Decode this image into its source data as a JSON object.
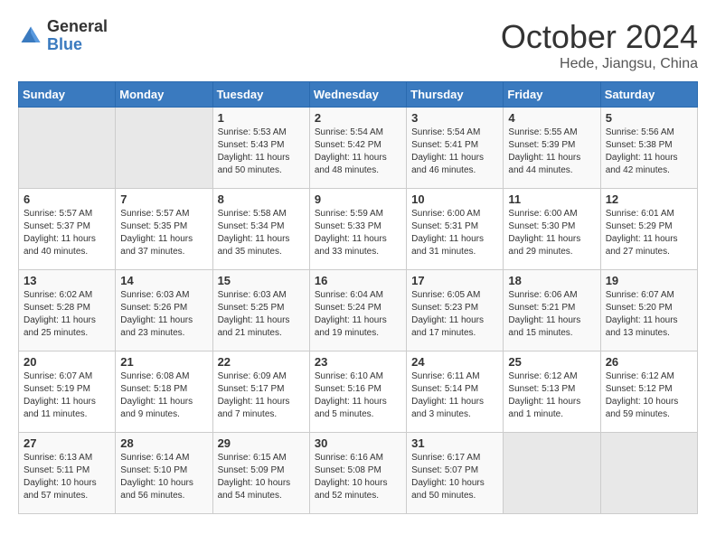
{
  "header": {
    "logo_general": "General",
    "logo_blue": "Blue",
    "month": "October 2024",
    "location": "Hede, Jiangsu, China"
  },
  "weekdays": [
    "Sunday",
    "Monday",
    "Tuesday",
    "Wednesday",
    "Thursday",
    "Friday",
    "Saturday"
  ],
  "weeks": [
    [
      {
        "day": "",
        "info": ""
      },
      {
        "day": "",
        "info": ""
      },
      {
        "day": "1",
        "info": "Sunrise: 5:53 AM\nSunset: 5:43 PM\nDaylight: 11 hours and 50 minutes."
      },
      {
        "day": "2",
        "info": "Sunrise: 5:54 AM\nSunset: 5:42 PM\nDaylight: 11 hours and 48 minutes."
      },
      {
        "day": "3",
        "info": "Sunrise: 5:54 AM\nSunset: 5:41 PM\nDaylight: 11 hours and 46 minutes."
      },
      {
        "day": "4",
        "info": "Sunrise: 5:55 AM\nSunset: 5:39 PM\nDaylight: 11 hours and 44 minutes."
      },
      {
        "day": "5",
        "info": "Sunrise: 5:56 AM\nSunset: 5:38 PM\nDaylight: 11 hours and 42 minutes."
      }
    ],
    [
      {
        "day": "6",
        "info": "Sunrise: 5:57 AM\nSunset: 5:37 PM\nDaylight: 11 hours and 40 minutes."
      },
      {
        "day": "7",
        "info": "Sunrise: 5:57 AM\nSunset: 5:35 PM\nDaylight: 11 hours and 37 minutes."
      },
      {
        "day": "8",
        "info": "Sunrise: 5:58 AM\nSunset: 5:34 PM\nDaylight: 11 hours and 35 minutes."
      },
      {
        "day": "9",
        "info": "Sunrise: 5:59 AM\nSunset: 5:33 PM\nDaylight: 11 hours and 33 minutes."
      },
      {
        "day": "10",
        "info": "Sunrise: 6:00 AM\nSunset: 5:31 PM\nDaylight: 11 hours and 31 minutes."
      },
      {
        "day": "11",
        "info": "Sunrise: 6:00 AM\nSunset: 5:30 PM\nDaylight: 11 hours and 29 minutes."
      },
      {
        "day": "12",
        "info": "Sunrise: 6:01 AM\nSunset: 5:29 PM\nDaylight: 11 hours and 27 minutes."
      }
    ],
    [
      {
        "day": "13",
        "info": "Sunrise: 6:02 AM\nSunset: 5:28 PM\nDaylight: 11 hours and 25 minutes."
      },
      {
        "day": "14",
        "info": "Sunrise: 6:03 AM\nSunset: 5:26 PM\nDaylight: 11 hours and 23 minutes."
      },
      {
        "day": "15",
        "info": "Sunrise: 6:03 AM\nSunset: 5:25 PM\nDaylight: 11 hours and 21 minutes."
      },
      {
        "day": "16",
        "info": "Sunrise: 6:04 AM\nSunset: 5:24 PM\nDaylight: 11 hours and 19 minutes."
      },
      {
        "day": "17",
        "info": "Sunrise: 6:05 AM\nSunset: 5:23 PM\nDaylight: 11 hours and 17 minutes."
      },
      {
        "day": "18",
        "info": "Sunrise: 6:06 AM\nSunset: 5:21 PM\nDaylight: 11 hours and 15 minutes."
      },
      {
        "day": "19",
        "info": "Sunrise: 6:07 AM\nSunset: 5:20 PM\nDaylight: 11 hours and 13 minutes."
      }
    ],
    [
      {
        "day": "20",
        "info": "Sunrise: 6:07 AM\nSunset: 5:19 PM\nDaylight: 11 hours and 11 minutes."
      },
      {
        "day": "21",
        "info": "Sunrise: 6:08 AM\nSunset: 5:18 PM\nDaylight: 11 hours and 9 minutes."
      },
      {
        "day": "22",
        "info": "Sunrise: 6:09 AM\nSunset: 5:17 PM\nDaylight: 11 hours and 7 minutes."
      },
      {
        "day": "23",
        "info": "Sunrise: 6:10 AM\nSunset: 5:16 PM\nDaylight: 11 hours and 5 minutes."
      },
      {
        "day": "24",
        "info": "Sunrise: 6:11 AM\nSunset: 5:14 PM\nDaylight: 11 hours and 3 minutes."
      },
      {
        "day": "25",
        "info": "Sunrise: 6:12 AM\nSunset: 5:13 PM\nDaylight: 11 hours and 1 minute."
      },
      {
        "day": "26",
        "info": "Sunrise: 6:12 AM\nSunset: 5:12 PM\nDaylight: 10 hours and 59 minutes."
      }
    ],
    [
      {
        "day": "27",
        "info": "Sunrise: 6:13 AM\nSunset: 5:11 PM\nDaylight: 10 hours and 57 minutes."
      },
      {
        "day": "28",
        "info": "Sunrise: 6:14 AM\nSunset: 5:10 PM\nDaylight: 10 hours and 56 minutes."
      },
      {
        "day": "29",
        "info": "Sunrise: 6:15 AM\nSunset: 5:09 PM\nDaylight: 10 hours and 54 minutes."
      },
      {
        "day": "30",
        "info": "Sunrise: 6:16 AM\nSunset: 5:08 PM\nDaylight: 10 hours and 52 minutes."
      },
      {
        "day": "31",
        "info": "Sunrise: 6:17 AM\nSunset: 5:07 PM\nDaylight: 10 hours and 50 minutes."
      },
      {
        "day": "",
        "info": ""
      },
      {
        "day": "",
        "info": ""
      }
    ]
  ]
}
